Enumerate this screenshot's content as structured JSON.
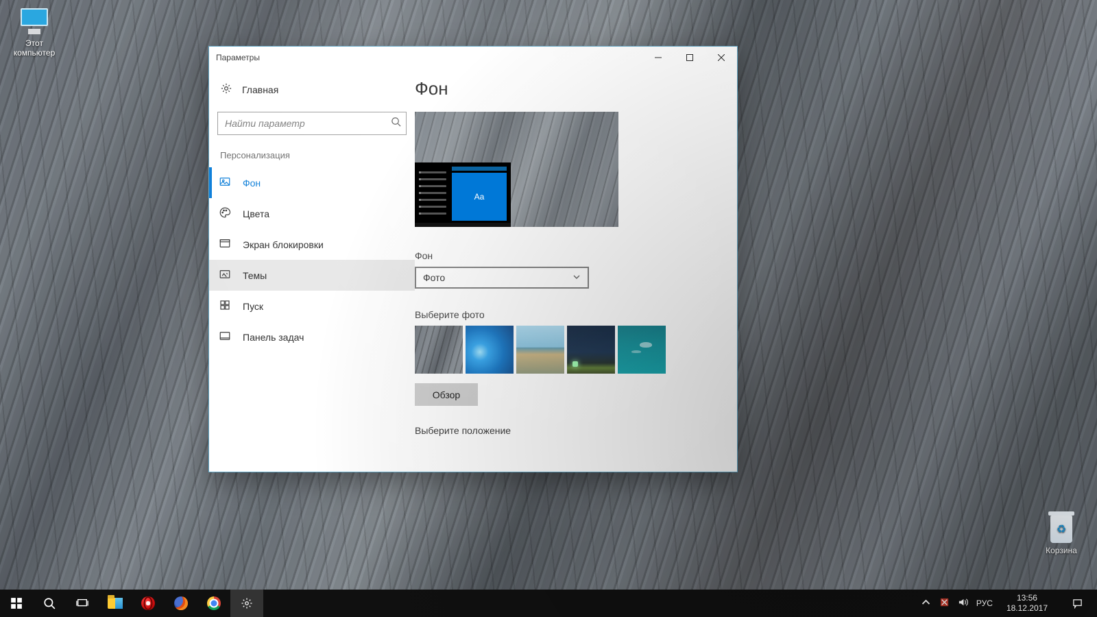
{
  "desktop": {
    "icons": {
      "this_pc": "Этот\nкомпьютер",
      "recycle_bin": "Корзина"
    }
  },
  "window": {
    "title": "Параметры",
    "home": "Главная",
    "search_placeholder": "Найти параметр",
    "category": "Персонализация",
    "nav": {
      "background": "Фон",
      "colors": "Цвета",
      "lockscreen": "Экран блокировки",
      "themes": "Темы",
      "start": "Пуск",
      "taskbar": "Панель задач"
    }
  },
  "main": {
    "heading": "Фон",
    "preview_aa": "Aa",
    "bg_label": "Фон",
    "bg_value": "Фото",
    "choose_label": "Выберите фото",
    "browse": "Обзор",
    "fit_label": "Выберите положение"
  },
  "tray": {
    "lang": "РУС",
    "time": "13:56",
    "date": "18.12.2017"
  }
}
